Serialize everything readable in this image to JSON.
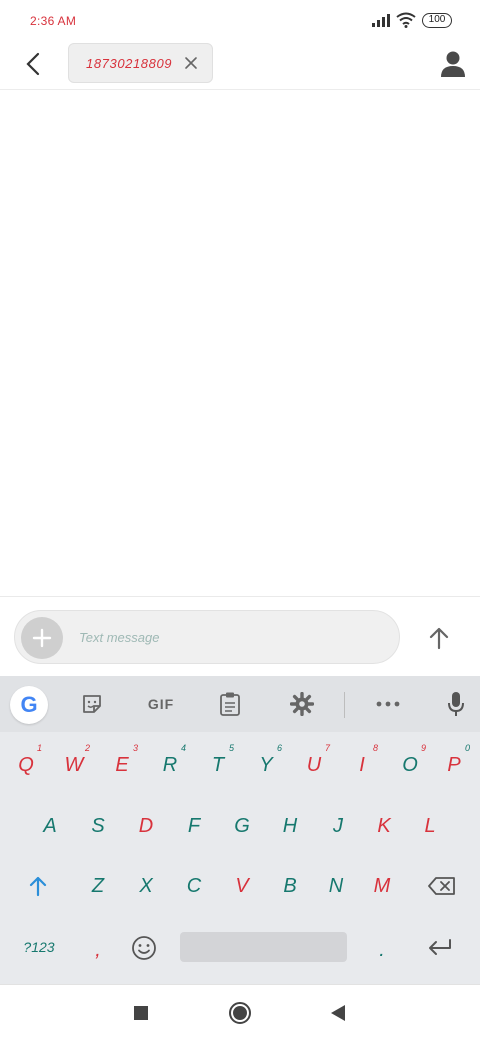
{
  "status_bar": {
    "time": "2:36 AM",
    "battery": "100"
  },
  "header": {
    "recipient": "18730218809"
  },
  "compose": {
    "placeholder": "Text message"
  },
  "keyboard": {
    "toolbar": {
      "gif_label": "GIF"
    },
    "row1": [
      {
        "label": "Q",
        "hint": "1"
      },
      {
        "label": "W",
        "hint": "2"
      },
      {
        "label": "E",
        "hint": "3"
      },
      {
        "label": "R",
        "hint": "4"
      },
      {
        "label": "T",
        "hint": "5"
      },
      {
        "label": "Y",
        "hint": "6"
      },
      {
        "label": "U",
        "hint": "7"
      },
      {
        "label": "I",
        "hint": "8"
      },
      {
        "label": "O",
        "hint": "9"
      },
      {
        "label": "P",
        "hint": "0"
      }
    ],
    "row2": [
      "A",
      "S",
      "D",
      "F",
      "G",
      "H",
      "J",
      "K",
      "L"
    ],
    "row3": [
      "Z",
      "X",
      "C",
      "V",
      "B",
      "N",
      "M"
    ],
    "symbols_label": "?123",
    "comma": ",",
    "period": "."
  }
}
